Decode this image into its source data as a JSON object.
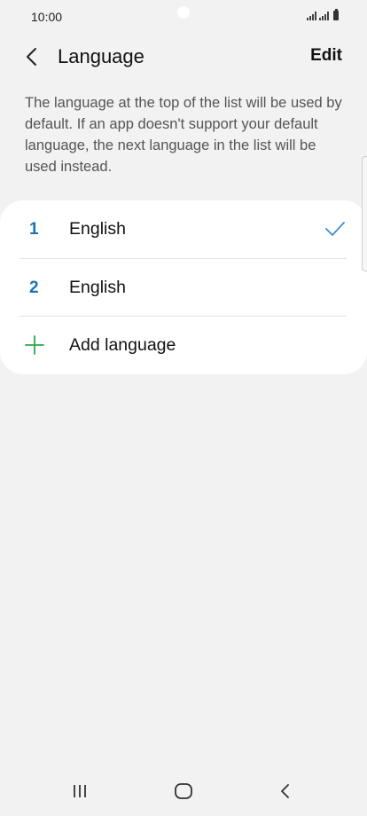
{
  "status_bar": {
    "time": "10:00"
  },
  "header": {
    "title": "Language",
    "edit_label": "Edit"
  },
  "description": "The language at the top of the list will be used by default. If an app doesn't support your default language, the next language in the list will be used instead.",
  "languages": [
    {
      "index": "1",
      "label": "English",
      "selected": true
    },
    {
      "index": "2",
      "label": "English",
      "selected": false
    }
  ],
  "add_language_label": "Add language",
  "colors": {
    "background": "#f2f2f2",
    "card": "#ffffff",
    "index_blue": "#1a73b8",
    "check_blue": "#3b8fd6",
    "plus_green": "#2aa84a"
  },
  "icons": {
    "back": "chevron-left-icon",
    "selected": "check-icon",
    "add": "plus-icon",
    "nav_recents": "recents-icon",
    "nav_home": "home-icon",
    "nav_back": "back-icon"
  }
}
